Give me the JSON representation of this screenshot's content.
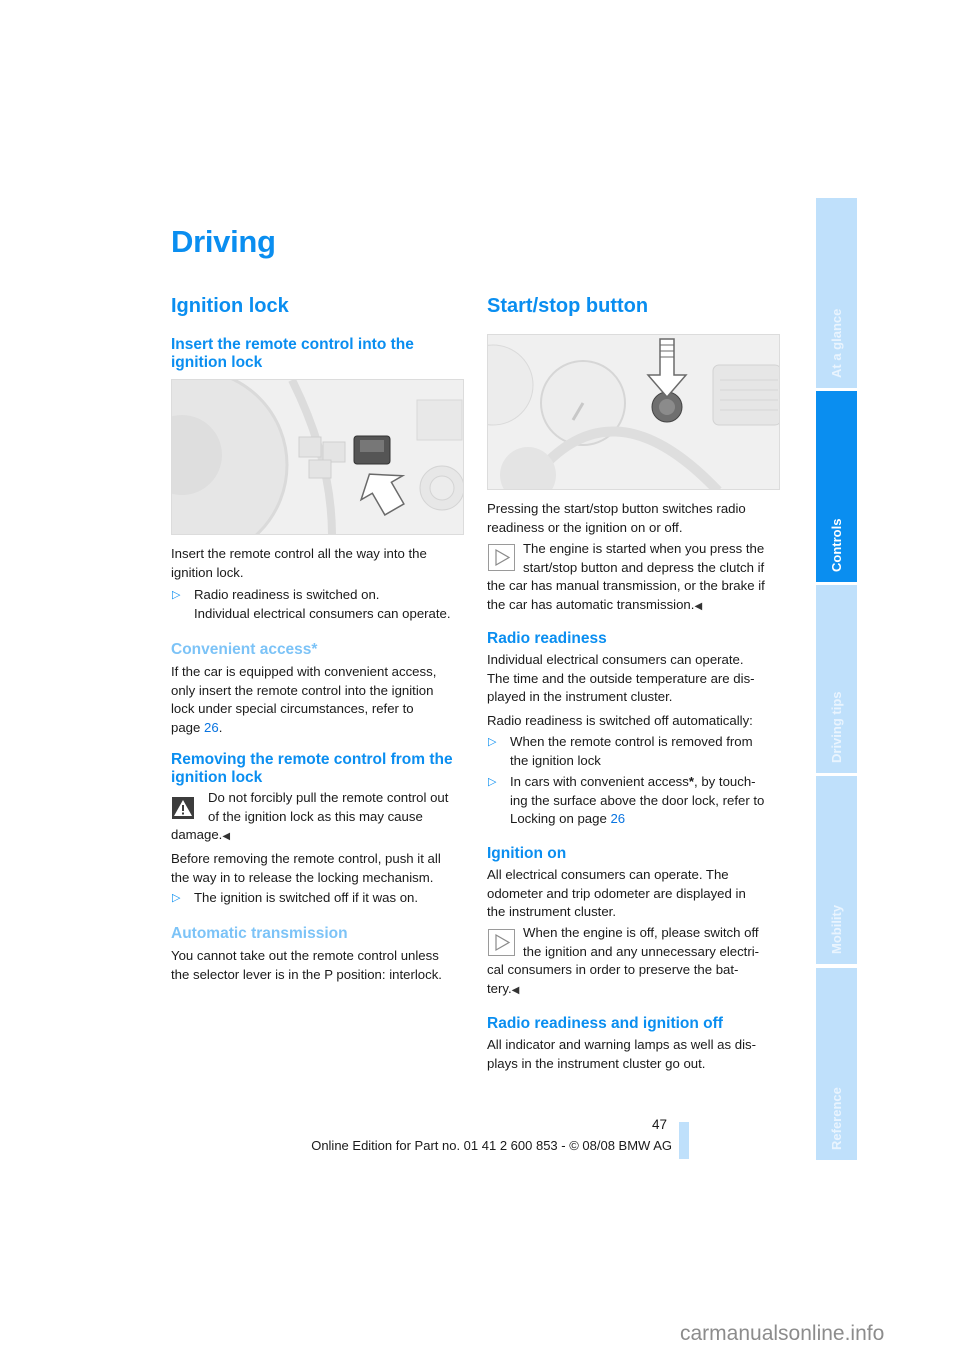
{
  "page": {
    "title": "Driving",
    "page_number": "47",
    "footer": "Online Edition for Part no. 01 41 2 600 853 - © 08/08 BMW AG",
    "watermark": "carmanualsonline.info"
  },
  "side_nav": {
    "tabs": [
      {
        "label": "At a glance",
        "active": false
      },
      {
        "label": "Controls",
        "active": true
      },
      {
        "label": "Driving tips",
        "active": false
      },
      {
        "label": "Mobility",
        "active": false
      },
      {
        "label": "Reference",
        "active": false
      }
    ]
  },
  "left": {
    "section_title": "Ignition lock",
    "insert": {
      "heading_line1": "Insert the remote control into the",
      "heading_line2": "ignition lock",
      "figure_alt": "Remote control being inserted into ignition lock next to steering wheel",
      "text_line1": "Insert the remote control all the way into the",
      "text_line2": "ignition lock.",
      "bullet_marker": "▷",
      "bullet_line1": "Radio readiness is switched on.",
      "bullet_line2": "Individual electrical consumers can operate."
    },
    "convenient": {
      "heading": "Convenient access*",
      "line1": "If the car is equipped with convenient access,",
      "line2": "only insert the remote control into the ignition",
      "line3": "lock under special circumstances, refer to",
      "line4_prefix": "page ",
      "page_ref": "26",
      "line4_suffix": "."
    },
    "removing": {
      "heading_line1": "Removing the remote control from the",
      "heading_line2": "ignition lock",
      "warning_line1": "Do not forcibly pull the remote control out",
      "warning_line2": "of the ignition lock as this may cause",
      "warning_line3": "damage.",
      "end_mark": "◀",
      "text_line1": "Before removing the remote control, push it all",
      "text_line2": "the way in to release the locking mechanism.",
      "bullet": "The ignition is switched off if it was on."
    },
    "automatic": {
      "heading": "Automatic transmission",
      "line1": "You cannot take out the remote control unless",
      "line2": "the selector lever is in the P position: interlock."
    }
  },
  "right": {
    "section_title": "Start/stop button",
    "figure_alt": "Start/stop button on dashboard with arrow",
    "intro_line1": "Pressing the start/stop button switches radio",
    "intro_line2": "readiness or the ignition on or off.",
    "note1_line1": "The engine is started when you press the",
    "note1_line2": "start/stop button and depress the clutch if",
    "note1_line3": "the car has manual transmission, or the brake if",
    "note1_line4": "the car has automatic transmission.",
    "radio": {
      "heading": "Radio readiness",
      "line1": "Individual electrical consumers can operate.",
      "line2": "The time and the outside temperature are dis-",
      "line3": "played in the instrument cluster.",
      "line4": "Radio readiness is switched off automatically:",
      "bullet1_line1": "When the remote control is removed from",
      "bullet1_line2": "the ignition lock",
      "bullet2_line1_a": "In cars with convenient access",
      "bullet2_star": "*",
      "bullet2_line1_b": ", by touch-",
      "bullet2_line2": "ing the surface above the door lock, refer to",
      "bullet2_line3_prefix": "Locking on page ",
      "bullet2_page_ref": "26"
    },
    "ignition_on": {
      "heading": "Ignition on",
      "line1": "All electrical consumers can operate. The",
      "line2": "odometer and trip odometer are displayed in",
      "line3": "the instrument cluster.",
      "note_line1": "When the engine is off, please switch off",
      "note_line2": "the ignition and any unnecessary electri-",
      "note_line3": "cal consumers in order to preserve the bat-",
      "note_line4": "tery."
    },
    "off": {
      "heading": "Radio readiness and ignition off",
      "line1": "All indicator and warning lamps as well as dis-",
      "line2": "plays in the instrument cluster go out."
    }
  }
}
